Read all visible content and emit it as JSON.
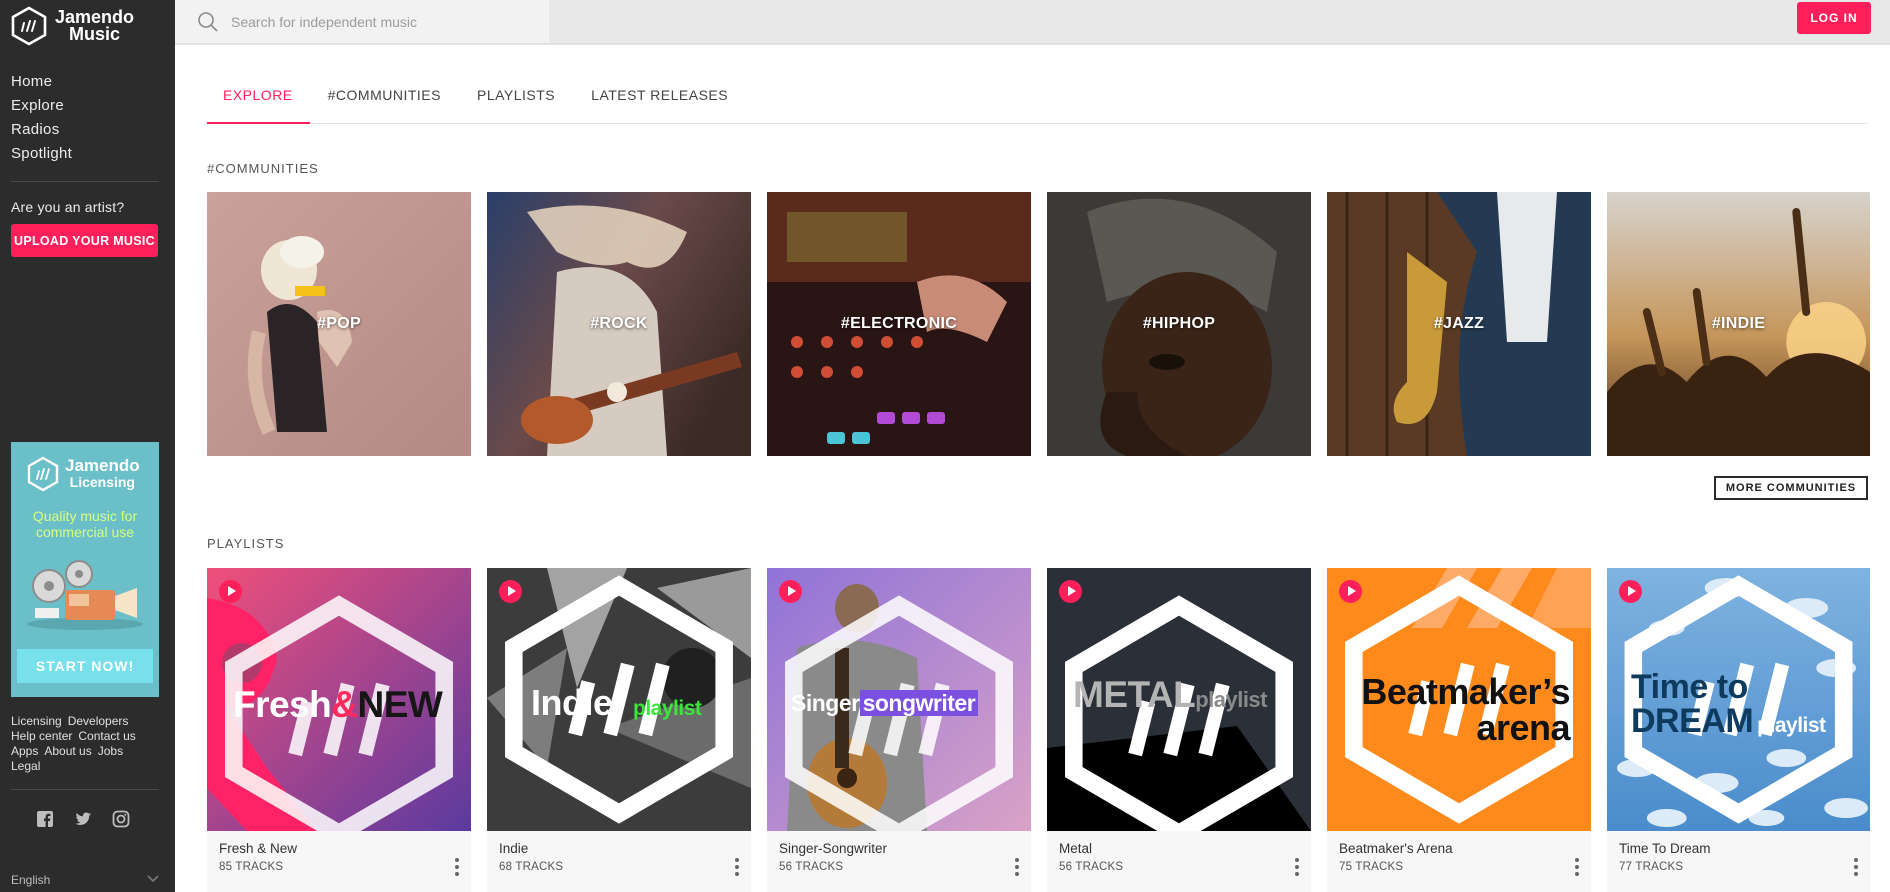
{
  "brand": {
    "line1": "Jamendo",
    "line2": "Music"
  },
  "sidebar": {
    "nav": [
      "Home",
      "Explore",
      "Radios",
      "Spotlight"
    ],
    "artist_question": "Are you an artist?",
    "upload_label": "UPLOAD YOUR MUSIC",
    "licensing": {
      "line1": "Jamendo",
      "line2": "Licensing",
      "tagline": "Quality music for commercial use",
      "cta": "START NOW!"
    },
    "footer_links": [
      "Licensing",
      "Developers",
      "Help center",
      "Contact us",
      "Apps",
      "About us",
      "Jobs",
      "Legal"
    ],
    "social_icons": [
      "facebook-icon",
      "twitter-icon",
      "instagram-icon"
    ],
    "language": "English"
  },
  "topbar": {
    "search_placeholder": "Search for independent music",
    "login_label": "LOG IN"
  },
  "tabs": [
    {
      "label": "EXPLORE",
      "active": true
    },
    {
      "label": "#COMMUNITIES",
      "active": false
    },
    {
      "label": "PLAYLISTS",
      "active": false
    },
    {
      "label": "LATEST RELEASES",
      "active": false
    }
  ],
  "communities": {
    "title": "#COMMUNITIES",
    "items": [
      {
        "label": "#POP"
      },
      {
        "label": "#ROCK"
      },
      {
        "label": "#ELECTRONIC"
      },
      {
        "label": "#HIPHOP"
      },
      {
        "label": "#JAZZ"
      },
      {
        "label": "#INDIE"
      }
    ],
    "more_label": "MORE COMMUNITIES"
  },
  "playlists": {
    "title": "PLAYLISTS",
    "items": [
      {
        "name": "Fresh & New",
        "tracks": "85 TRACKS",
        "cover_a": "Fresh",
        "cover_b": "&",
        "cover_c": "NEW"
      },
      {
        "name": "Indie",
        "tracks": "68 TRACKS",
        "cover_a": "Indie",
        "cover_b": "playlist"
      },
      {
        "name": "Singer-Songwriter",
        "tracks": "56 TRACKS",
        "cover_a": "Singer",
        "cover_b": "songwriter"
      },
      {
        "name": "Metal",
        "tracks": "56 TRACKS",
        "cover_a": "METAL",
        "cover_b": "playlist"
      },
      {
        "name": "Beatmaker's Arena",
        "tracks": "75 TRACKS",
        "cover_a": "Beatmaker’s",
        "cover_b": "arena"
      },
      {
        "name": "Time To Dream",
        "tracks": "77 TRACKS",
        "cover_a": "Time to",
        "cover_b": "DREAM",
        "cover_c": "playlist"
      }
    ]
  },
  "colors": {
    "accent": "#ff1f5a",
    "sidebar": "#2c2c2c",
    "licensing_bg": "#6bbfc8"
  }
}
